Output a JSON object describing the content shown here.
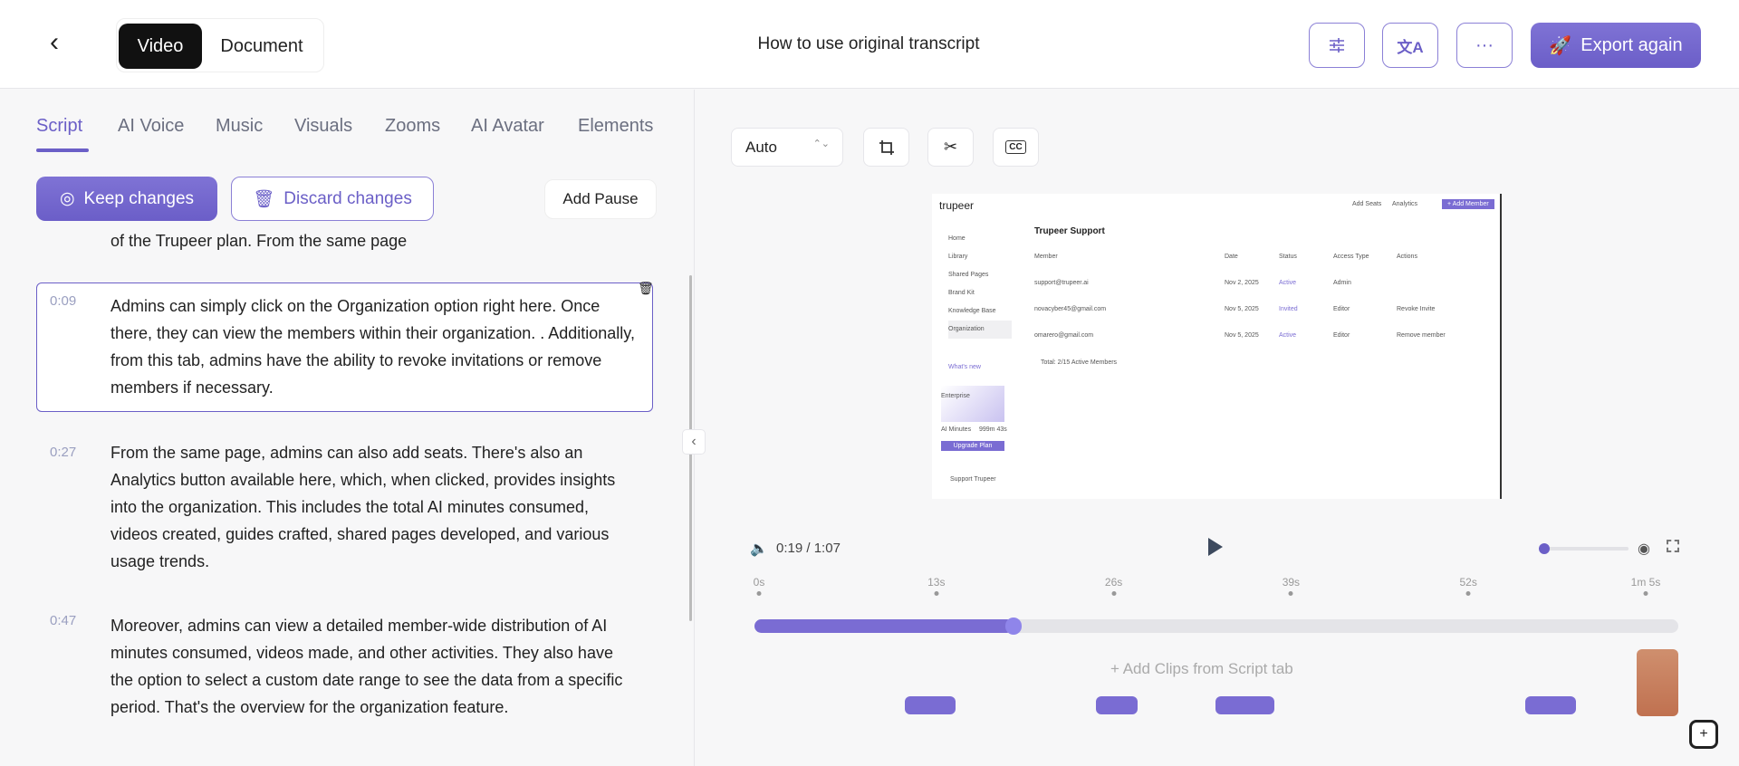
{
  "header": {
    "title": "How to use original transcript",
    "toggle": [
      "Video",
      "Document"
    ],
    "export_label": "Export again"
  },
  "tabs": [
    "Script",
    "AI Voice",
    "Music",
    "Visuals",
    "Zooms",
    "AI Avatar",
    "Elements"
  ],
  "actions": {
    "keep": "Keep changes",
    "discard": "Discard changes",
    "add_pause": "Add Pause"
  },
  "script": {
    "partial": "of the Trupeer plan. From the same page",
    "segments": [
      {
        "time": "0:09",
        "text": "Admins can simply click on the Organization option right here. Once there, they can view the members within their organization. . Additionally, from this tab, admins have the ability to revoke invitations or remove members if necessary."
      },
      {
        "time": "0:27",
        "text": "From the same page, admins can also add seats. There's also an Analytics button available here, which, when clicked, provides insights into the organization. This includes the total AI minutes consumed, videos created, guides crafted, shared pages developed, and various usage trends."
      },
      {
        "time": "0:47",
        "text": "Moreover, admins can view a detailed member-wide distribution of AI minutes consumed, videos made, and other activities. They also have the option to select a custom date range to see the data from a specific period. That's the overview for the organization feature."
      }
    ]
  },
  "player": {
    "aspect": "Auto",
    "cc": "CC",
    "current": "0:19",
    "duration": "1:07",
    "progress": 0.28,
    "zoom_level": 0.0,
    "ticks": [
      "0s",
      "13s",
      "26s",
      "39s",
      "52s",
      "1m 5s"
    ],
    "add_clips": "Add Clips from Script tab"
  },
  "preview": {
    "logo": "trupeer",
    "heading": "Trupeer Support",
    "top_buttons": [
      "Add Seats",
      "Analytics",
      "+ Add Member"
    ],
    "nav": [
      "Home",
      "Library",
      "Shared Pages",
      "Brand Kit",
      "Knowledge Base",
      "Organization"
    ],
    "columns": [
      "Member",
      "Date",
      "Status",
      "Access Type",
      "Actions"
    ],
    "rows": [
      [
        "support@trupeer.ai",
        "Nov 2, 2025",
        "Active",
        "Admin",
        ""
      ],
      [
        "novacyber45@gmail.com",
        "Nov 5, 2025",
        "Invited",
        "Editor",
        "Revoke Invite"
      ],
      [
        "omarero@gmail.com",
        "Nov 5, 2025",
        "Active",
        "Editor",
        "Remove member"
      ]
    ],
    "total": "Total: 2/15 Active Members",
    "whats_new": "What's new",
    "plan": "Enterprise",
    "minutes_label": "AI Minutes",
    "minutes_value": "999m 43s",
    "upgrade": "Upgrade Plan",
    "user": "Support Trupeer"
  },
  "colors": {
    "accent": "#6b5fc7",
    "clip": "#7a6cd3",
    "orange": "#c5775a"
  }
}
